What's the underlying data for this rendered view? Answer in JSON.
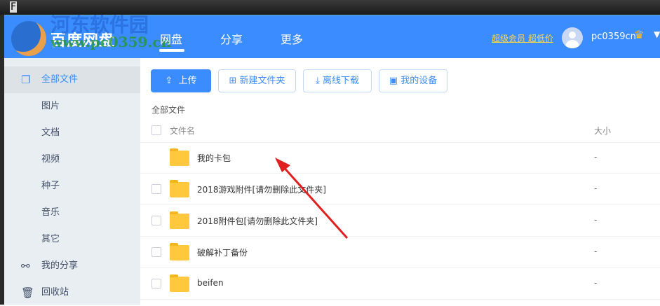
{
  "window": {
    "corner_letter": "F"
  },
  "header": {
    "logo_text": "百度网盘",
    "watermark_cn": "河东软件园",
    "watermark_url": "www.pc0359.cn",
    "nav": [
      {
        "label": "网盘",
        "active": true
      },
      {
        "label": "分享"
      },
      {
        "label": "更多"
      }
    ],
    "vip_link": "超级会员 超低价",
    "username": "pc0359cn"
  },
  "sidebar": {
    "items": [
      {
        "label": "全部文件",
        "icon": "files-icon",
        "active": true
      },
      {
        "label": "图片"
      },
      {
        "label": "文档"
      },
      {
        "label": "视频"
      },
      {
        "label": "种子"
      },
      {
        "label": "音乐"
      },
      {
        "label": "其它"
      },
      {
        "label": "我的分享",
        "icon": "share-icon"
      },
      {
        "label": "回收站",
        "icon": "trash-icon"
      }
    ]
  },
  "toolbar": {
    "upload": "上传",
    "new_folder": "新建文件夹",
    "offline_download": "离线下载",
    "my_devices": "我的设备"
  },
  "breadcrumb": "全部文件",
  "table": {
    "col_name": "文件名",
    "col_size": "大小",
    "rows": [
      {
        "name": "我的卡包",
        "size": "-"
      },
      {
        "name": "2018游戏附件[请勿删除此文件夹]",
        "size": "-"
      },
      {
        "name": "2018附件包[请勿删除此文件夹]",
        "size": "-"
      },
      {
        "name": "破解补丁备份",
        "size": "-"
      },
      {
        "name": "beifen",
        "size": "-"
      }
    ]
  },
  "colors": {
    "brand": "#3b8cff",
    "sidebar": "#e8eef2",
    "folder": "#ffc83d",
    "arrow": "#e02020"
  }
}
